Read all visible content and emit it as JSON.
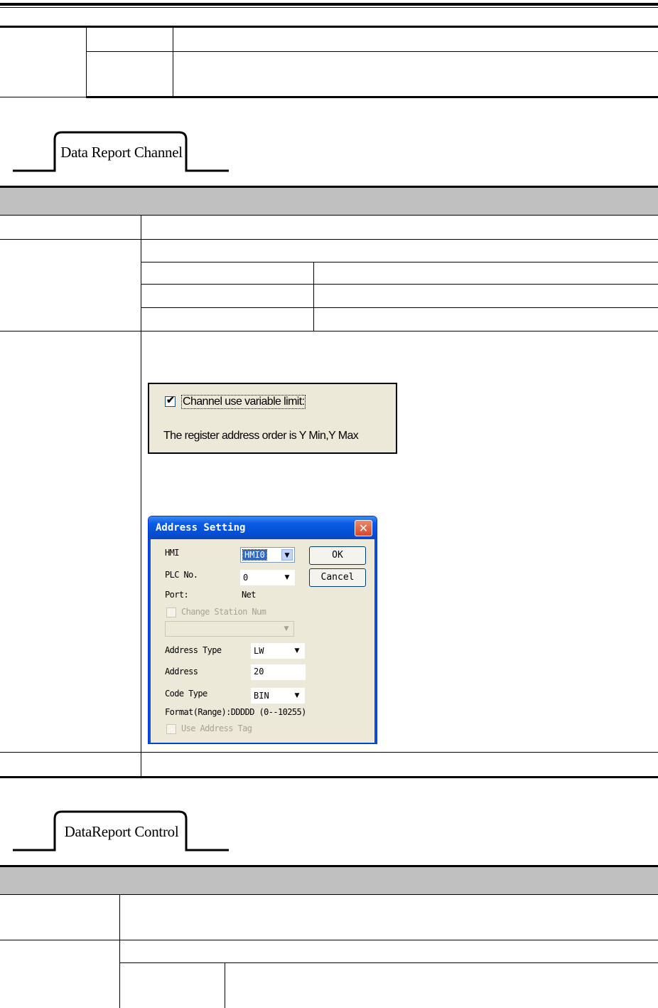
{
  "page": {
    "section_one_tab": "Data Report Channel",
    "section_two_tab": "DataReport Control"
  },
  "checkbox_panel": {
    "checkbox_label": "Channel use variable limit:",
    "checked": true,
    "note": "The register address order is Y Min,Y Max"
  },
  "address_dialog": {
    "title": "Address Setting",
    "close_glyph": "✕",
    "hmi_label": "HMI",
    "hmi_value": "HMI0",
    "plc_label": "PLC No.",
    "plc_value": "0",
    "port_label": "Port:",
    "port_value": "Net",
    "change_station_label": "Change Station Num",
    "address_type_label": "Address Type",
    "address_type_value": "LW",
    "address_label": "Address",
    "address_value": "20",
    "code_type_label": "Code Type",
    "code_type_value": "BIN",
    "format_text": "Format(Range):DDDDD (0--10255)",
    "use_tag_label": "Use Address Tag",
    "ok_label": "OK",
    "cancel_label": "Cancel"
  },
  "icons": {
    "dropdown_arrow": "▼",
    "check_mark": "✔"
  }
}
